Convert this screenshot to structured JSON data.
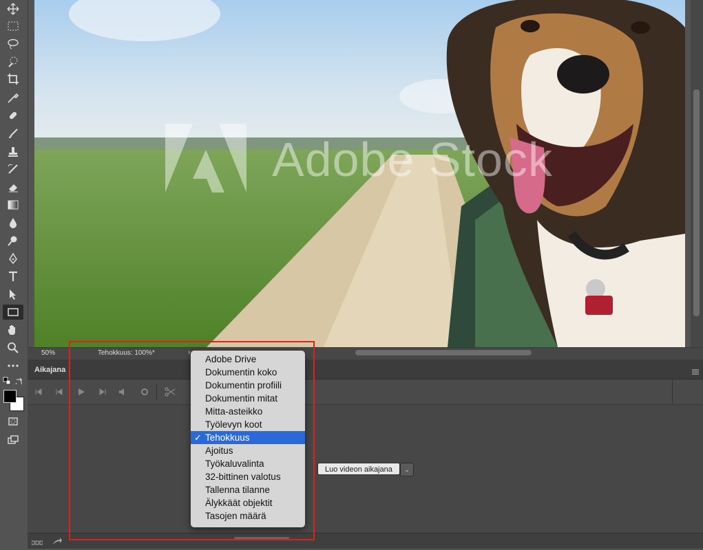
{
  "canvas": {
    "watermark_text": "Adobe Stock"
  },
  "status_bar": {
    "zoom": "50%",
    "info": "Tehokkuus: 100%*"
  },
  "timeline": {
    "title": "Aikajana",
    "create_button_label": "Luo videon aikajana",
    "dropdown_arrow": "⌄"
  },
  "menu": {
    "items": [
      {
        "label": "Adobe Drive",
        "selected": false
      },
      {
        "label": "Dokumentin koko",
        "selected": false
      },
      {
        "label": "Dokumentin profiili",
        "selected": false
      },
      {
        "label": "Dokumentin mitat",
        "selected": false
      },
      {
        "label": "Mitta-asteikko",
        "selected": false
      },
      {
        "label": "Työlevyn koot",
        "selected": false
      },
      {
        "label": "Tehokkuus",
        "selected": true
      },
      {
        "label": "Ajoitus",
        "selected": false
      },
      {
        "label": "Työkaluvalinta",
        "selected": false
      },
      {
        "label": "32-bittinen valotus",
        "selected": false
      },
      {
        "label": "Tallenna tilanne",
        "selected": false
      },
      {
        "label": "Älykkäät objektit",
        "selected": false
      },
      {
        "label": "Tasojen määrä",
        "selected": false
      }
    ],
    "check_glyph": "✓"
  },
  "colors": {
    "accent": "#2a6ad8",
    "highlight_box": "#e02020",
    "ui_bg": "#535353"
  }
}
